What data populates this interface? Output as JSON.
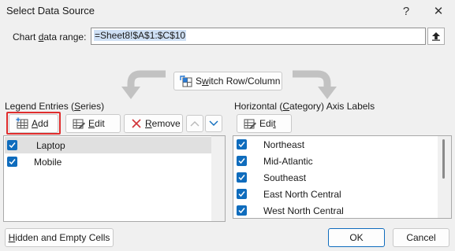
{
  "window": {
    "title": "Select Data Source",
    "help_glyph": "?",
    "close_glyph": "✕"
  },
  "range": {
    "label_pre": "Chart ",
    "label_u": "d",
    "label_post": "ata range:",
    "value": "=Sheet8!$A$1:$C$10"
  },
  "switch": {
    "label_pre": "S",
    "label_u": "w",
    "label_post": "itch Row/Column"
  },
  "legend": {
    "label_pre": "Legend Entries (",
    "label_u": "S",
    "label_post": "eries)",
    "add_u": "A",
    "add_post": "dd",
    "edit_u": "E",
    "edit_post": "dit",
    "remove_u": "R",
    "remove_post": "emove",
    "items": [
      {
        "label": "Laptop",
        "checked": true,
        "selected": true
      },
      {
        "label": "Mobile",
        "checked": true,
        "selected": false
      }
    ]
  },
  "axis": {
    "label_pre": "Horizontal (",
    "label_u": "C",
    "label_post": "ategory) Axis Labels",
    "edit_pre": "Edi",
    "edit_u": "t",
    "items": [
      {
        "label": "Northeast",
        "checked": true
      },
      {
        "label": "Mid-Atlantic",
        "checked": true
      },
      {
        "label": "Southeast",
        "checked": true
      },
      {
        "label": "East North Central",
        "checked": true
      },
      {
        "label": "West North Central",
        "checked": true
      }
    ]
  },
  "footer": {
    "hidden_pre": "",
    "hidden_u": "H",
    "hidden_post": "idden and Empty Cells",
    "ok": "OK",
    "cancel": "Cancel"
  },
  "colors": {
    "accent": "#0f6cbd",
    "highlight": "#e02d2d",
    "selection": "#e0e0e0"
  }
}
